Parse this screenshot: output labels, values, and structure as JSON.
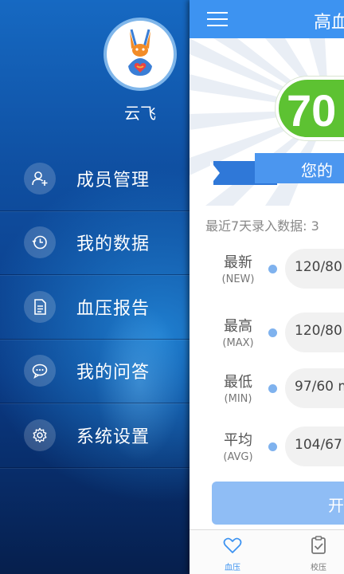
{
  "drawer": {
    "user_name": "云飞",
    "items": [
      {
        "label": "成员管理",
        "icon": "add-member-icon"
      },
      {
        "label": "我的数据",
        "icon": "history-clock-icon"
      },
      {
        "label": "血压报告",
        "icon": "document-icon"
      },
      {
        "label": "我的问答",
        "icon": "chat-bubble-icon"
      },
      {
        "label": "系统设置",
        "icon": "gear-icon"
      }
    ]
  },
  "main": {
    "title": "高血",
    "score": "70",
    "ribbon_text": "您的",
    "recent_text": "最近7天录入数据: 3",
    "stats": [
      {
        "name": "最新",
        "sub": "(NEW)",
        "value": "120/80"
      },
      {
        "name": "最高",
        "sub": "(MAX)",
        "value": "120/80"
      },
      {
        "name": "最低",
        "sub": "(MIN)",
        "value": "97/60 m"
      },
      {
        "name": "平均",
        "sub": "(AVG)",
        "value": "104/67"
      }
    ],
    "start_button": "开",
    "tabs": [
      {
        "label": "血压",
        "icon": "heart-icon",
        "active": true
      },
      {
        "label": "校压",
        "icon": "clipboard-check-icon",
        "active": false
      }
    ]
  },
  "colors": {
    "accent": "#3d93f1",
    "score_green": "#5dc232",
    "drawer_top": "#1669c2",
    "drawer_bottom": "#061f4d"
  }
}
